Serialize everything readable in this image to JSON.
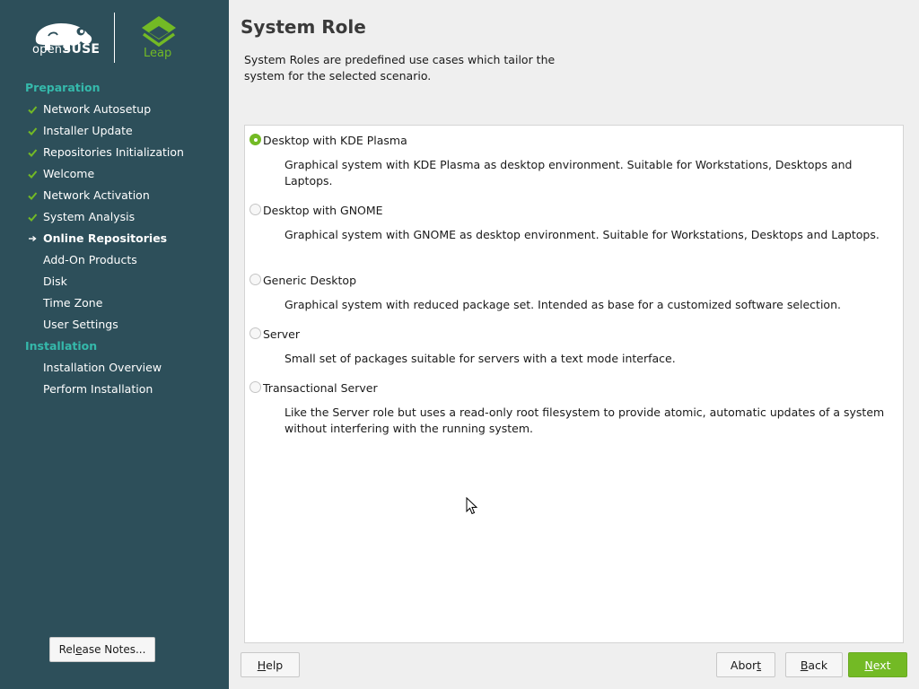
{
  "brand": {
    "opensuse_prefix": "open",
    "opensuse_suffix": "SUSE",
    "product": "Leap",
    "colors": {
      "sidebar": "#2d4f5a",
      "accent_green": "#73ba25",
      "section_teal": "#35b9ab"
    }
  },
  "sidebar": {
    "sections": [
      {
        "title": "Preparation",
        "steps": [
          {
            "label": "Network Autosetup",
            "state": "done"
          },
          {
            "label": "Installer Update",
            "state": "done"
          },
          {
            "label": "Repositories Initialization",
            "state": "done"
          },
          {
            "label": "Welcome",
            "state": "done"
          },
          {
            "label": "Network Activation",
            "state": "done"
          },
          {
            "label": "System Analysis",
            "state": "done"
          },
          {
            "label": "Online Repositories",
            "state": "current"
          },
          {
            "label": "Add-On Products",
            "state": "pending"
          },
          {
            "label": "Disk",
            "state": "pending"
          },
          {
            "label": "Time Zone",
            "state": "pending"
          },
          {
            "label": "User Settings",
            "state": "pending"
          }
        ]
      },
      {
        "title": "Installation",
        "steps": [
          {
            "label": "Installation Overview",
            "state": "pending"
          },
          {
            "label": "Perform Installation",
            "state": "pending"
          }
        ]
      }
    ],
    "release_notes": {
      "pre": "Rel",
      "key": "e",
      "post": "ase Notes..."
    }
  },
  "main": {
    "title": "System Role",
    "description": "System Roles are predefined use cases which tailor the system for the selected scenario.",
    "roles": [
      {
        "label": "Desktop with KDE Plasma",
        "selected": true,
        "description": "Graphical system with KDE Plasma as desktop environment. Suitable for Workstations, Desktops and Laptops."
      },
      {
        "label": "Desktop with GNOME",
        "selected": false,
        "description": "Graphical system with GNOME as desktop environment. Suitable for Workstations, Desktops and Laptops."
      },
      {
        "label": "Generic Desktop",
        "selected": false,
        "description": "Graphical system with reduced package set. Intended as base for a customized software selection."
      },
      {
        "label": "Server",
        "selected": false,
        "description": "Small set of packages suitable for servers with a text mode interface."
      },
      {
        "label": "Transactional Server",
        "selected": false,
        "description": "Like the Server role but uses a read-only root filesystem to provide atomic, automatic updates of a system without interfering with the running system."
      }
    ]
  },
  "buttons": {
    "help": {
      "key": "H",
      "rest": "elp"
    },
    "abort": {
      "pre": "Abor",
      "key": "t",
      "post": ""
    },
    "back": {
      "key": "B",
      "rest": "ack"
    },
    "next": {
      "key": "N",
      "rest": "ext"
    }
  },
  "icons": {
    "done": "checkmark-icon",
    "current": "arrow-right-icon",
    "brand_logo": "chameleon-logo-icon",
    "product_logo": "leap-logo-icon",
    "pointer": "mouse-cursor-icon"
  }
}
